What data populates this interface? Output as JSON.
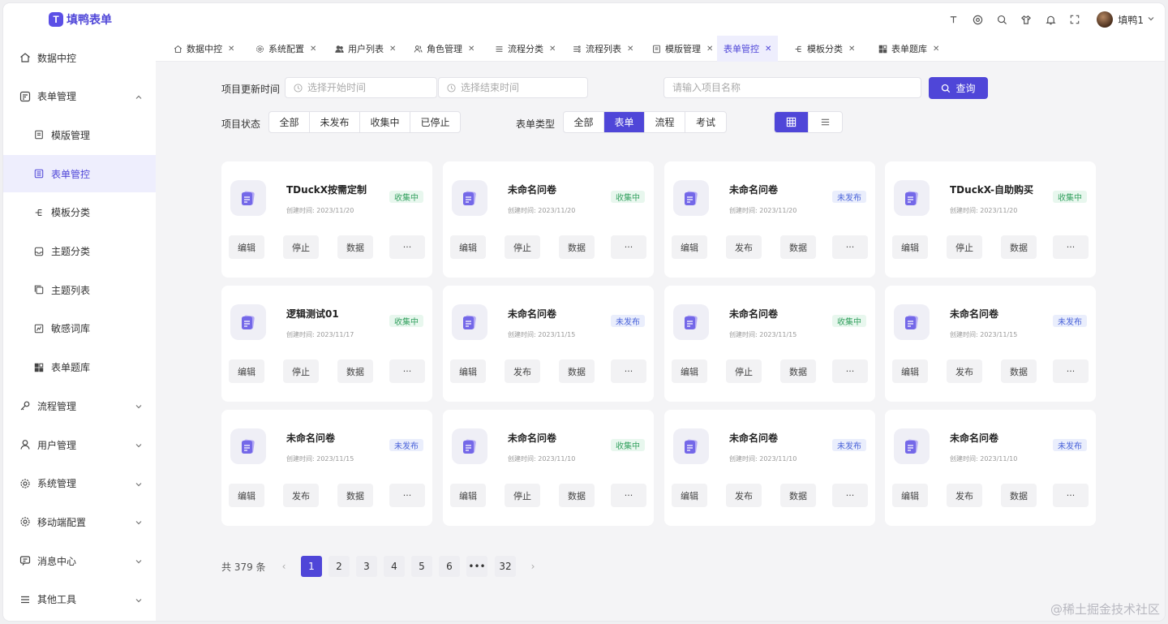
{
  "app": {
    "logo_letter": "T",
    "title": "填鸭表单",
    "brand_color": "#4f46d8"
  },
  "header": {
    "icons": [
      "text-size-icon",
      "target-icon",
      "search-icon",
      "shirt-icon",
      "bell-icon",
      "fullscreen-icon"
    ],
    "user_name": "填鸭1"
  },
  "sidebar": {
    "items": [
      {
        "label": "数据中控",
        "icon": "home-icon",
        "type": "top"
      },
      {
        "label": "表单管理",
        "icon": "form-icon",
        "type": "top",
        "expanded": true
      },
      {
        "label": "模版管理",
        "icon": "template-icon",
        "type": "sub"
      },
      {
        "label": "表单管控",
        "icon": "list-box-icon",
        "type": "sub",
        "active": true
      },
      {
        "label": "模板分类",
        "icon": "tree-icon",
        "type": "sub"
      },
      {
        "label": "主题分类",
        "icon": "inbox-icon",
        "type": "sub"
      },
      {
        "label": "主题列表",
        "icon": "stack-icon",
        "type": "sub"
      },
      {
        "label": "敏感词库",
        "icon": "chart-box-icon",
        "type": "sub"
      },
      {
        "label": "表单题库",
        "icon": "grid-icon",
        "type": "sub"
      },
      {
        "label": "流程管理",
        "icon": "key-icon",
        "type": "top",
        "expanded": false
      },
      {
        "label": "用户管理",
        "icon": "user-icon",
        "type": "top",
        "expanded": false
      },
      {
        "label": "系统管理",
        "icon": "gear-icon",
        "type": "top",
        "expanded": false
      },
      {
        "label": "移动端配置",
        "icon": "gear-icon",
        "type": "top",
        "expanded": false
      },
      {
        "label": "消息中心",
        "icon": "message-icon",
        "type": "top",
        "expanded": false
      },
      {
        "label": "其他工具",
        "icon": "menu-icon",
        "type": "top",
        "expanded": false
      }
    ]
  },
  "tabs": [
    {
      "label": "数据中控",
      "icon": "home-icon"
    },
    {
      "label": "系统配置",
      "icon": "gear-icon"
    },
    {
      "label": "用户列表",
      "icon": "users-icon"
    },
    {
      "label": "角色管理",
      "icon": "role-icon"
    },
    {
      "label": "流程分类",
      "icon": "menu-icon"
    },
    {
      "label": "流程列表",
      "icon": "flow-icon"
    },
    {
      "label": "模版管理",
      "icon": "template-icon"
    },
    {
      "label": "表单管控",
      "icon": "",
      "active": true
    },
    {
      "label": "模板分类",
      "icon": "tree-icon"
    },
    {
      "label": "表单题库",
      "icon": "grid-icon"
    }
  ],
  "filters": {
    "update_time_label": "项目更新时间",
    "start_placeholder": "选择开始时间",
    "end_placeholder": "选择结束时间",
    "name_placeholder": "请输入项目名称",
    "query_label": "查询",
    "status_label": "项目状态",
    "status_options": [
      "全部",
      "未发布",
      "收集中",
      "已停止"
    ],
    "type_label": "表单类型",
    "type_options": [
      "全部",
      "表单",
      "流程",
      "考试"
    ],
    "type_selected": 1,
    "view_modes": [
      "grid-view-icon",
      "list-view-icon"
    ]
  },
  "cards": [
    {
      "title": "TDuckX按需定制",
      "date": "创建时间: 2023/11/20",
      "status": "收集中",
      "status_kind": "collecting",
      "actions": [
        "编辑",
        "停止",
        "数据",
        "···"
      ]
    },
    {
      "title": "未命名问卷",
      "date": "创建时间: 2023/11/20",
      "status": "收集中",
      "status_kind": "collecting",
      "actions": [
        "编辑",
        "停止",
        "数据",
        "···"
      ]
    },
    {
      "title": "未命名问卷",
      "date": "创建时间: 2023/11/20",
      "status": "未发布",
      "status_kind": "unpublished",
      "actions": [
        "编辑",
        "发布",
        "数据",
        "···"
      ]
    },
    {
      "title": "TDuckX-自助购买",
      "date": "创建时间: 2023/11/20",
      "status": "收集中",
      "status_kind": "collecting",
      "actions": [
        "编辑",
        "停止",
        "数据",
        "···"
      ]
    },
    {
      "title": "逻辑测试01",
      "date": "创建时间: 2023/11/17",
      "status": "收集中",
      "status_kind": "collecting",
      "actions": [
        "编辑",
        "停止",
        "数据",
        "···"
      ]
    },
    {
      "title": "未命名问卷",
      "date": "创建时间: 2023/11/15",
      "status": "未发布",
      "status_kind": "unpublished",
      "actions": [
        "编辑",
        "发布",
        "数据",
        "···"
      ]
    },
    {
      "title": "未命名问卷",
      "date": "创建时间: 2023/11/15",
      "status": "收集中",
      "status_kind": "collecting",
      "actions": [
        "编辑",
        "停止",
        "数据",
        "···"
      ]
    },
    {
      "title": "未命名问卷",
      "date": "创建时间: 2023/11/15",
      "status": "未发布",
      "status_kind": "unpublished",
      "actions": [
        "编辑",
        "发布",
        "数据",
        "···"
      ]
    },
    {
      "title": "未命名问卷",
      "date": "创建时间: 2023/11/15",
      "status": "未发布",
      "status_kind": "unpublished",
      "actions": [
        "编辑",
        "发布",
        "数据",
        "···"
      ]
    },
    {
      "title": "未命名问卷",
      "date": "创建时间: 2023/11/10",
      "status": "收集中",
      "status_kind": "collecting",
      "actions": [
        "编辑",
        "停止",
        "数据",
        "···"
      ]
    },
    {
      "title": "未命名问卷",
      "date": "创建时间: 2023/11/10",
      "status": "未发布",
      "status_kind": "unpublished",
      "actions": [
        "编辑",
        "发布",
        "数据",
        "···"
      ]
    },
    {
      "title": "未命名问卷",
      "date": "创建时间: 2023/11/10",
      "status": "未发布",
      "status_kind": "unpublished",
      "actions": [
        "编辑",
        "发布",
        "数据",
        "···"
      ]
    }
  ],
  "pagination": {
    "total_text": "共 379 条",
    "prev": "‹",
    "next": "›",
    "pages": [
      "1",
      "2",
      "3",
      "4",
      "5",
      "6",
      "•••",
      "32"
    ],
    "current": "1"
  },
  "watermark": "@稀土掘金技术社区"
}
